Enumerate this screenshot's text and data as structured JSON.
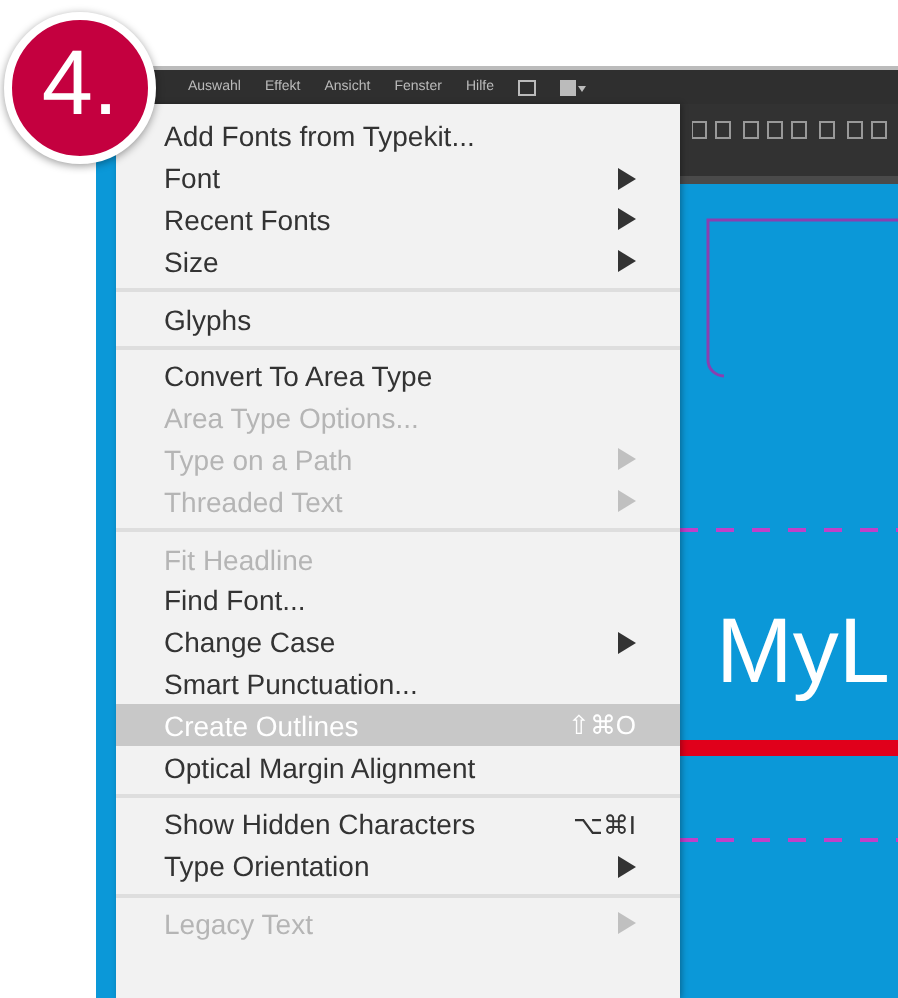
{
  "badge": {
    "label": "4."
  },
  "menubar": {
    "items": [
      "Auswahl",
      "Effekt",
      "Ansicht",
      "Fenster",
      "Hilfe"
    ]
  },
  "canvas": {
    "text": "MyL"
  },
  "menu": {
    "groups": [
      {
        "items": [
          {
            "label": "Add Fonts from Typekit...",
            "disabled": false,
            "submenu": false,
            "selected": false
          },
          {
            "label": "Font",
            "disabled": false,
            "submenu": true,
            "selected": false
          },
          {
            "label": "Recent Fonts",
            "disabled": false,
            "submenu": true,
            "selected": false
          },
          {
            "label": "Size",
            "disabled": false,
            "submenu": true,
            "selected": false
          }
        ]
      },
      {
        "items": [
          {
            "label": "Glyphs",
            "disabled": false,
            "submenu": false,
            "selected": false
          }
        ]
      },
      {
        "items": [
          {
            "label": "Convert To Area Type",
            "disabled": false,
            "submenu": false,
            "selected": false
          },
          {
            "label": "Area Type Options...",
            "disabled": true,
            "submenu": false,
            "selected": false
          },
          {
            "label": "Type on a Path",
            "disabled": true,
            "submenu": true,
            "selected": false
          },
          {
            "label": "Threaded Text",
            "disabled": true,
            "submenu": true,
            "selected": false
          }
        ]
      },
      {
        "items": [
          {
            "label": "Fit Headline",
            "disabled": true,
            "submenu": false,
            "selected": false
          },
          {
            "label": "Find Font...",
            "disabled": false,
            "submenu": false,
            "selected": false
          },
          {
            "label": "Change Case",
            "disabled": false,
            "submenu": true,
            "selected": false
          },
          {
            "label": "Smart Punctuation...",
            "disabled": false,
            "submenu": false,
            "selected": false
          },
          {
            "label": "Create Outlines",
            "disabled": false,
            "submenu": false,
            "selected": true,
            "shortcut": "⇧⌘O"
          },
          {
            "label": "Optical Margin Alignment",
            "disabled": false,
            "submenu": false,
            "selected": false
          }
        ]
      },
      {
        "items": [
          {
            "label": "Show Hidden Characters",
            "disabled": false,
            "submenu": false,
            "selected": false,
            "shortcut": "⌥⌘I"
          },
          {
            "label": "Type Orientation",
            "disabled": false,
            "submenu": true,
            "selected": false
          }
        ]
      },
      {
        "items": [
          {
            "label": "Legacy Text",
            "disabled": true,
            "submenu": true,
            "selected": false
          }
        ]
      }
    ]
  }
}
